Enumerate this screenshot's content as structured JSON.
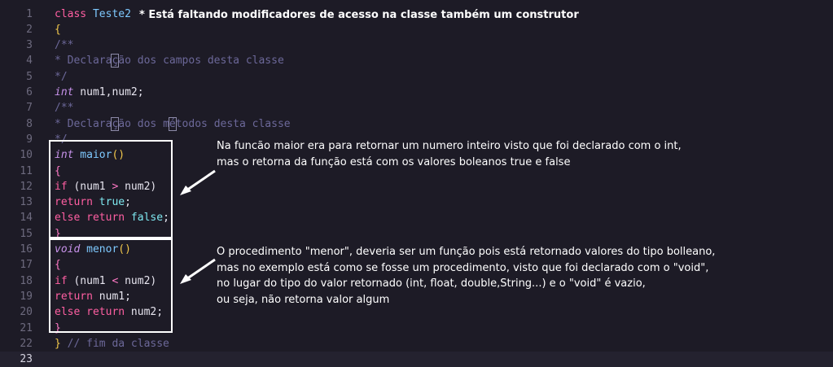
{
  "editor": {
    "current_line": "23",
    "lines": [
      {
        "n": "1",
        "tokens": [
          {
            "t": "class ",
            "c": "kw"
          },
          {
            "t": "Teste2",
            "c": "fn"
          }
        ]
      },
      {
        "n": "2",
        "tokens": [
          {
            "t": "{",
            "c": "br"
          }
        ]
      },
      {
        "n": "3",
        "tokens": [
          {
            "t": "/**",
            "c": "cm"
          }
        ]
      },
      {
        "n": "4",
        "tokens": [
          {
            "t": "* Declara",
            "c": "cm"
          },
          {
            "t": "ç",
            "c": "cm",
            "mark": true
          },
          {
            "t": "ão dos campos desta classe",
            "c": "cm"
          }
        ]
      },
      {
        "n": "5",
        "tokens": [
          {
            "t": "*/",
            "c": "cm"
          }
        ]
      },
      {
        "n": "6",
        "tokens": [
          {
            "t": "int",
            "c": "ty"
          },
          {
            "t": " num1,num2;",
            "c": "pl"
          }
        ]
      },
      {
        "n": "7",
        "tokens": [
          {
            "t": "/**",
            "c": "cm"
          }
        ]
      },
      {
        "n": "8",
        "tokens": [
          {
            "t": "* Declara",
            "c": "cm"
          },
          {
            "t": "ç",
            "c": "cm",
            "mark": true
          },
          {
            "t": "ão dos m",
            "c": "cm"
          },
          {
            "t": "é",
            "c": "cm",
            "mark": true
          },
          {
            "t": "todos desta classe",
            "c": "cm"
          }
        ]
      },
      {
        "n": "9",
        "tokens": [
          {
            "t": "*/",
            "c": "cm"
          }
        ]
      },
      {
        "n": "10",
        "tokens": [
          {
            "t": "int",
            "c": "ty"
          },
          {
            "t": " maior",
            "c": "fn"
          },
          {
            "t": "()",
            "c": "br"
          }
        ]
      },
      {
        "n": "11",
        "tokens": [
          {
            "t": "{",
            "c": "op"
          }
        ]
      },
      {
        "n": "12",
        "tokens": [
          {
            "t": "if",
            "c": "kw"
          },
          {
            "t": " (num1 ",
            "c": "pl"
          },
          {
            "t": ">",
            "c": "op"
          },
          {
            "t": " num2)",
            "c": "pl"
          }
        ]
      },
      {
        "n": "13",
        "tokens": [
          {
            "t": "return",
            "c": "kw"
          },
          {
            "t": " ",
            "c": "pl"
          },
          {
            "t": "true",
            "c": "bool"
          },
          {
            "t": ";",
            "c": "pl"
          }
        ]
      },
      {
        "n": "14",
        "tokens": [
          {
            "t": "else return",
            "c": "kw"
          },
          {
            "t": " ",
            "c": "pl"
          },
          {
            "t": "false",
            "c": "bool"
          },
          {
            "t": ";",
            "c": "pl"
          }
        ]
      },
      {
        "n": "15",
        "tokens": [
          {
            "t": "}",
            "c": "op"
          }
        ]
      },
      {
        "n": "16",
        "tokens": [
          {
            "t": "void",
            "c": "ty"
          },
          {
            "t": " menor",
            "c": "fn"
          },
          {
            "t": "()",
            "c": "br"
          }
        ]
      },
      {
        "n": "17",
        "tokens": [
          {
            "t": "{",
            "c": "op"
          }
        ]
      },
      {
        "n": "18",
        "tokens": [
          {
            "t": "if",
            "c": "kw"
          },
          {
            "t": " (num1 ",
            "c": "pl"
          },
          {
            "t": "<",
            "c": "op"
          },
          {
            "t": " num2)",
            "c": "pl"
          }
        ]
      },
      {
        "n": "19",
        "tokens": [
          {
            "t": "return",
            "c": "kw"
          },
          {
            "t": " num1;",
            "c": "pl"
          }
        ]
      },
      {
        "n": "20",
        "tokens": [
          {
            "t": "else return",
            "c": "kw"
          },
          {
            "t": " num2;",
            "c": "pl"
          }
        ]
      },
      {
        "n": "21",
        "tokens": [
          {
            "t": "}",
            "c": "op"
          }
        ]
      },
      {
        "n": "22",
        "tokens": [
          {
            "t": "}",
            "c": "br"
          },
          {
            "t": " // fim da classe",
            "c": "cm"
          }
        ]
      },
      {
        "n": "23",
        "tokens": []
      }
    ]
  },
  "annotations": {
    "top_note": "* Está faltando modificadores de acesso na classe também um construtor",
    "maior_note": [
      "Na funcão maior era para retornar um numero inteiro visto que foi declarado com o int,",
      "mas o retorna da função está com os valores boleanos true e false"
    ],
    "menor_note": [
      "O procedimento \"menor\", deveria ser um função pois está retornado valores do tipo bolleano,",
      "mas no exemplo está como se fosse um procedimento, visto que foi declarado com o \"void\",",
      "no lugar do tipo do valor retornado (int, float, double,String...) e o \"void\" é vazio,",
      "ou seja, não retorna valor algum"
    ]
  },
  "colors": {
    "background": "#1d1b26",
    "keyword": "#ff5fa2",
    "type": "#c792ea",
    "function": "#7ec9ff",
    "boolean": "#7ee8f0",
    "comment": "#6c6899",
    "bracket": "#f2c84b",
    "annotation": "#ffffff"
  }
}
